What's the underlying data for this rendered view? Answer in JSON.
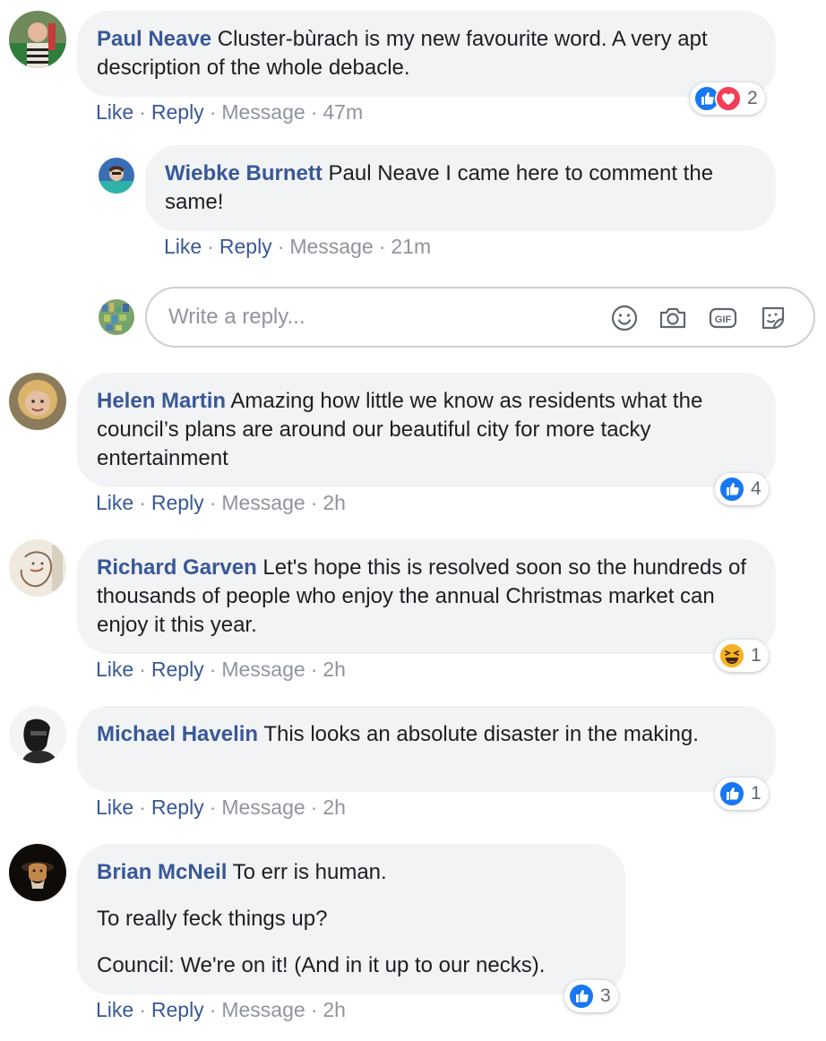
{
  "comments": [
    {
      "author": "Paul Neave",
      "text": "Cluster-bùrach is my new favourite word. A very apt description of the whole debacle.",
      "actions": {
        "like": "Like",
        "reply": "Reply",
        "message": "Message",
        "time": "47m"
      },
      "reactions": {
        "icons": [
          "like",
          "love"
        ],
        "count": "2"
      },
      "reply": {
        "author": "Wiebke Burnett",
        "text": "Paul Neave I came here to comment the same!",
        "actions": {
          "like": "Like",
          "reply": "Reply",
          "message": "Message",
          "time": "21m"
        }
      }
    },
    {
      "author": "Helen Martin",
      "text": "Amazing how little we know as residents what the council’s plans are around our beautiful city for more tacky entertainment",
      "actions": {
        "like": "Like",
        "reply": "Reply",
        "message": "Message",
        "time": "2h"
      },
      "reactions": {
        "icons": [
          "like"
        ],
        "count": "4"
      }
    },
    {
      "author": "Richard Garven",
      "text": "Let's hope this is resolved soon so the hundreds of thousands of people who enjoy the annual Christmas market can enjoy it this year.",
      "actions": {
        "like": "Like",
        "reply": "Reply",
        "message": "Message",
        "time": "2h"
      },
      "reactions": {
        "icons": [
          "haha"
        ],
        "count": "1"
      }
    },
    {
      "author": "Michael Havelin",
      "text": "This looks an absolute disaster in the making.",
      "actions": {
        "like": "Like",
        "reply": "Reply",
        "message": "Message",
        "time": "2h"
      },
      "reactions": {
        "icons": [
          "like"
        ],
        "count": "1"
      }
    },
    {
      "author": "Brian McNeil",
      "paragraphs": [
        "To err is human.",
        "To really feck things up?",
        "Council: We're on it! (And in it up to our necks)."
      ],
      "actions": {
        "like": "Like",
        "reply": "Reply",
        "message": "Message",
        "time": "2h"
      },
      "reactions": {
        "icons": [
          "like"
        ],
        "count": "3"
      }
    }
  ],
  "reply_composer": {
    "placeholder": "Write a reply...",
    "icons": [
      "smiley-icon",
      "camera-icon",
      "gif-icon",
      "sticker-icon"
    ]
  },
  "colors": {
    "link": "#385898",
    "meta": "#90949c",
    "bubble": "#f2f3f5",
    "like_blue": "#1877f2",
    "love_red": "#f33e58",
    "haha_yellow": "#f7b125"
  }
}
